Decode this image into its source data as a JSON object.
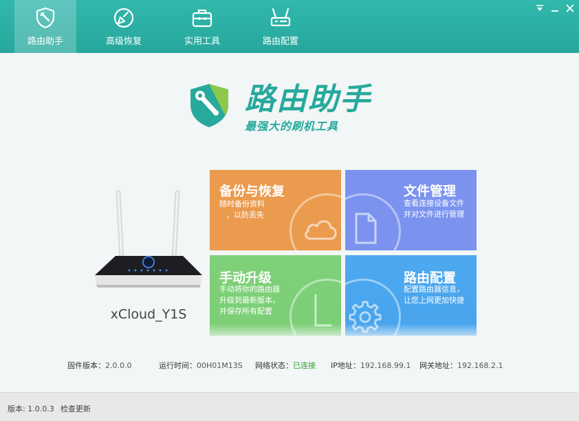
{
  "nav": {
    "tabs": [
      {
        "label": "路由助手",
        "icon": "wrench-shield-icon",
        "active": true
      },
      {
        "label": "高级恢复",
        "icon": "broom-icon",
        "active": false
      },
      {
        "label": "实用工具",
        "icon": "toolbox-icon",
        "active": false
      },
      {
        "label": "路由配置",
        "icon": "router-icon",
        "active": false
      }
    ]
  },
  "window_controls": [
    "menu-icon",
    "minimize-icon",
    "close-icon"
  ],
  "logo": {
    "title": "路由助手",
    "subtitle": "最强大的刷机工具",
    "icon": "shield-wrench-icon"
  },
  "router": {
    "name": "xCloud_Y1S"
  },
  "tiles": {
    "backup": {
      "title": "备份与恢复",
      "desc1": "随时备份资料",
      "desc2": "，以防丢失",
      "icon": "cloud-icon",
      "color": "#eb9b4e"
    },
    "file": {
      "title": "文件管理",
      "desc1": "查看连接设备文件",
      "desc2": "并对文件进行管理",
      "icon": "file-icon",
      "color": "#7b93ee"
    },
    "upgrade": {
      "title": "手动升级",
      "desc1": "手动将你的路由器",
      "desc2": "升级到最新版本，",
      "desc3": "并保存所有配置",
      "icon": "clock-icon",
      "color": "#7fd07a"
    },
    "config": {
      "title": "路由配置",
      "desc1": "配置路由器信息，",
      "desc2": "让您上网更加快捷",
      "icon": "gear-icon",
      "color": "#4da8ef"
    }
  },
  "status": {
    "firmware_label": "固件版本：",
    "firmware_value": "2.0.0.0",
    "uptime_label": "运行时间：",
    "uptime_value": "00H01M13S",
    "network_label": "网络状态：",
    "network_value": "已连接",
    "ip_label": "IP地址：",
    "ip_value": "192.168.99.1",
    "gateway_label": "网关地址：",
    "gateway_value": "192.168.2.1"
  },
  "footer": {
    "version": "版本: 1.0.0.3",
    "check_update": "检查更新"
  }
}
